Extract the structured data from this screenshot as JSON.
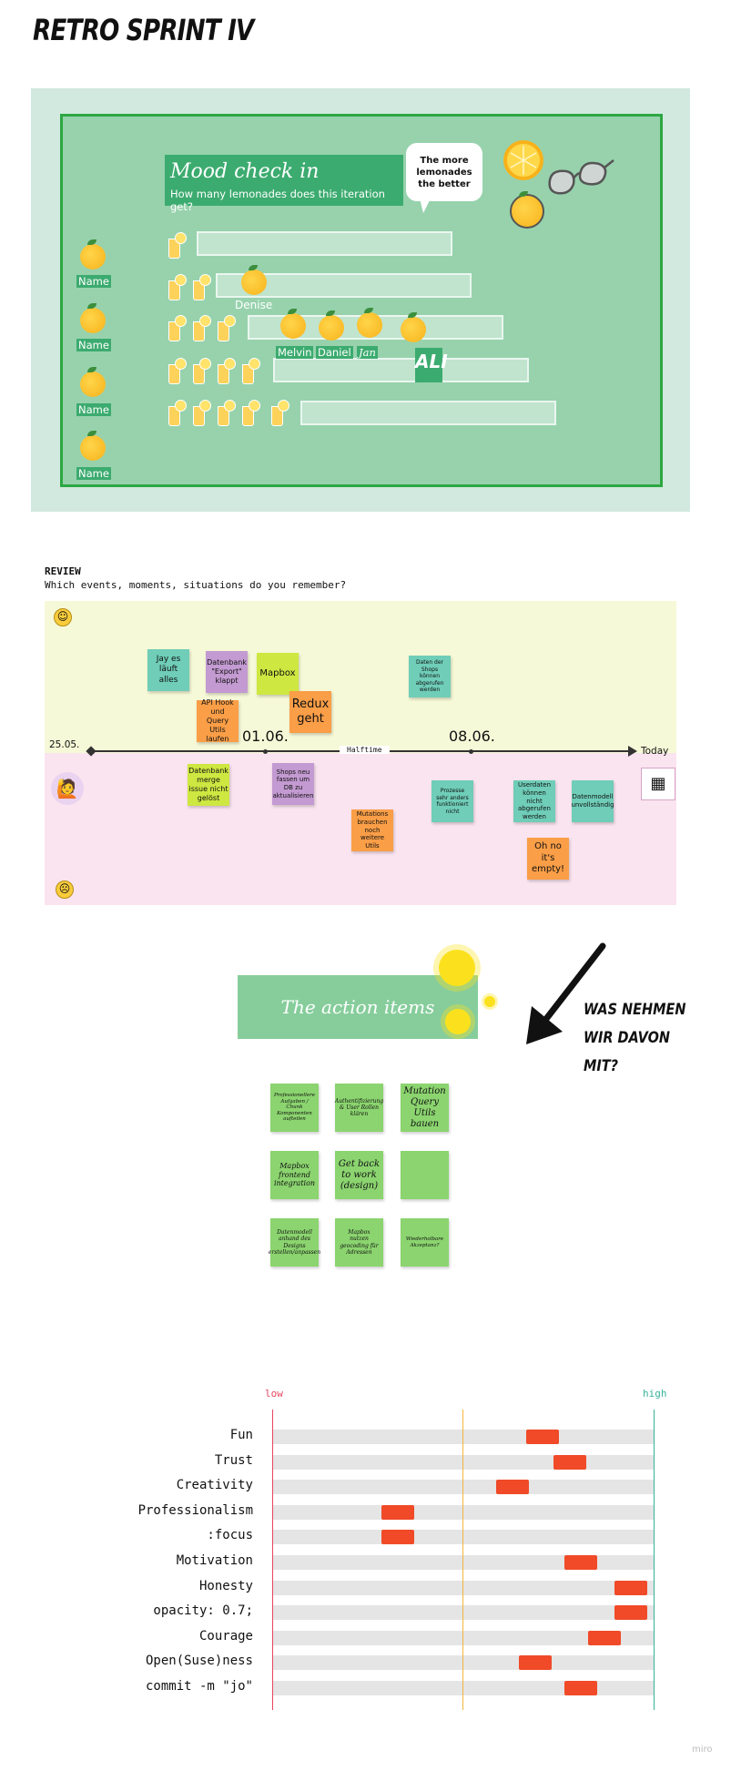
{
  "title": "RETRO SPRINT IV",
  "mood": {
    "heading": "Mood check in",
    "subheading": "How many lemonades does this iteration get?",
    "bubble": "The more lemonades the better",
    "name_label": "Name",
    "people": [
      "Denise",
      "Melvin",
      "Daniel",
      "Jan",
      "ALI"
    ],
    "rows_glasses": [
      1,
      2,
      3,
      4,
      5
    ]
  },
  "review": {
    "heading": "REVIEW",
    "subheading": "Which events, moments, situations do you remember?",
    "start_date": "25.05.",
    "date1": "01.06.",
    "date2": "08.06.",
    "halftime": "Halftime",
    "today": "Today",
    "notes_positive": [
      {
        "text": "Jay es läuft alles",
        "color": "#6fcdb8"
      },
      {
        "text": "Datenbank \"Export\" klappt",
        "color": "#c39ad1"
      },
      {
        "text": "Mapbox",
        "color": "#cee741"
      },
      {
        "text": "Redux geht",
        "color": "#fa9e47"
      },
      {
        "text": "API Hook und Query Utils laufen",
        "color": "#fa9e47"
      },
      {
        "text": "Daten der Shops können abgerufen werden",
        "color": "#6fcdb8"
      }
    ],
    "notes_negative": [
      {
        "text": "Datenbank merge issue nicht gelöst",
        "color": "#cee741"
      },
      {
        "text": "Shops neu fassen um DB zu aktualisieren",
        "color": "#c39ad1"
      },
      {
        "text": "Mutations brauchen noch weitere Utils",
        "color": "#fa9e47"
      },
      {
        "text": "Prozesse sehr anders funktioniert nicht",
        "color": "#6fcdb8"
      },
      {
        "text": "Userdaten können nicht abgerufen werden",
        "color": "#6fcdb8"
      },
      {
        "text": "Datenmodell unvollständig",
        "color": "#6fcdb8"
      },
      {
        "text": "Oh no it's empty!",
        "color": "#fa9e47"
      }
    ]
  },
  "actions": {
    "heading": "The action items",
    "side_text_1": "WAS NEHMEN",
    "side_text_2": "WIR DAVON",
    "side_text_3": "MIT?",
    "items": [
      "Professionellere Aufgaben / Chunk Komponenten aufteilen",
      "Authentifizierung & User Rollen klären",
      "Mutation Query Utils bauen",
      "Mapbox frontend integration",
      "Get back to work (design)",
      "",
      "Datenmodell anhand des Designs erstellen/anpassen",
      "Mapbox nutzen geocoding für Adressen",
      "Wiederholbare Akzeptanz?"
    ]
  },
  "values": {
    "low_label": "low",
    "high_label": "high",
    "low_color": "#e8455f",
    "high_color": "#35b39c",
    "mid_color": "#f2b53c",
    "marker_color": "#f04a28",
    "rows": [
      {
        "label": "Fun",
        "value": 0.71
      },
      {
        "label": "Trust",
        "value": 0.78
      },
      {
        "label": "Creativity",
        "value": 0.63
      },
      {
        "label": "Professionalism",
        "value": 0.33
      },
      {
        "label": ":focus",
        "value": 0.33
      },
      {
        "label": "Motivation",
        "value": 0.81
      },
      {
        "label": "Honesty",
        "value": 0.94
      },
      {
        "label": "opacity: 0.7;",
        "value": 0.94
      },
      {
        "label": "Courage",
        "value": 0.87
      },
      {
        "label": "Open(Suse)ness",
        "value": 0.69
      },
      {
        "label": "commit -m  \"jo\"",
        "value": 0.81
      }
    ]
  },
  "footer": "miro"
}
